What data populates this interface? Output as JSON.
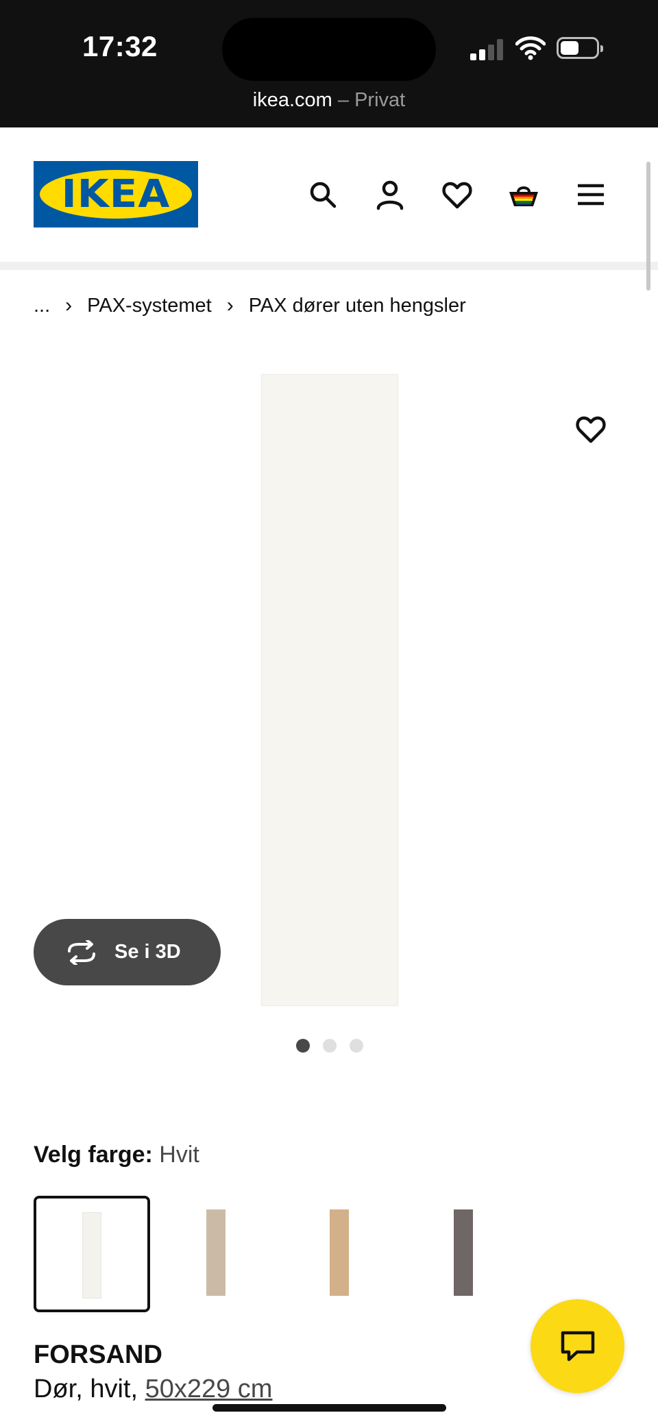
{
  "status_bar": {
    "time": "17:32",
    "url": "ikea.com",
    "url_suffix": " – Privat"
  },
  "header": {
    "logo_text": "IKEA",
    "icons": [
      "search-icon",
      "account-icon",
      "favourites-icon",
      "cart-icon",
      "menu-icon"
    ]
  },
  "breadcrumb": {
    "ellipsis": "...",
    "items": [
      "PAX-systemet",
      "PAX dører uten hengsler"
    ]
  },
  "gallery": {
    "view_3d_label": "Se i 3D",
    "image_count": 3,
    "active_image": 1
  },
  "color_chooser": {
    "label": "Velg farge:",
    "selected": "Hvit",
    "swatches": [
      {
        "name": "Hvit",
        "color": "#f3f2ec",
        "selected": true
      },
      {
        "name": "swatch-2",
        "color": "#cbbba6",
        "selected": false
      },
      {
        "name": "swatch-3",
        "color": "#d2b08a",
        "selected": false
      },
      {
        "name": "swatch-4",
        "color": "#6f6766",
        "selected": false
      }
    ]
  },
  "product": {
    "name": "FORSAND",
    "description_prefix": "Dør, hvit, ",
    "size_link": "50x229 cm"
  },
  "colors": {
    "brand_blue": "#0058a3",
    "brand_yellow": "#ffdb00",
    "chat_button": "#fbd914"
  }
}
